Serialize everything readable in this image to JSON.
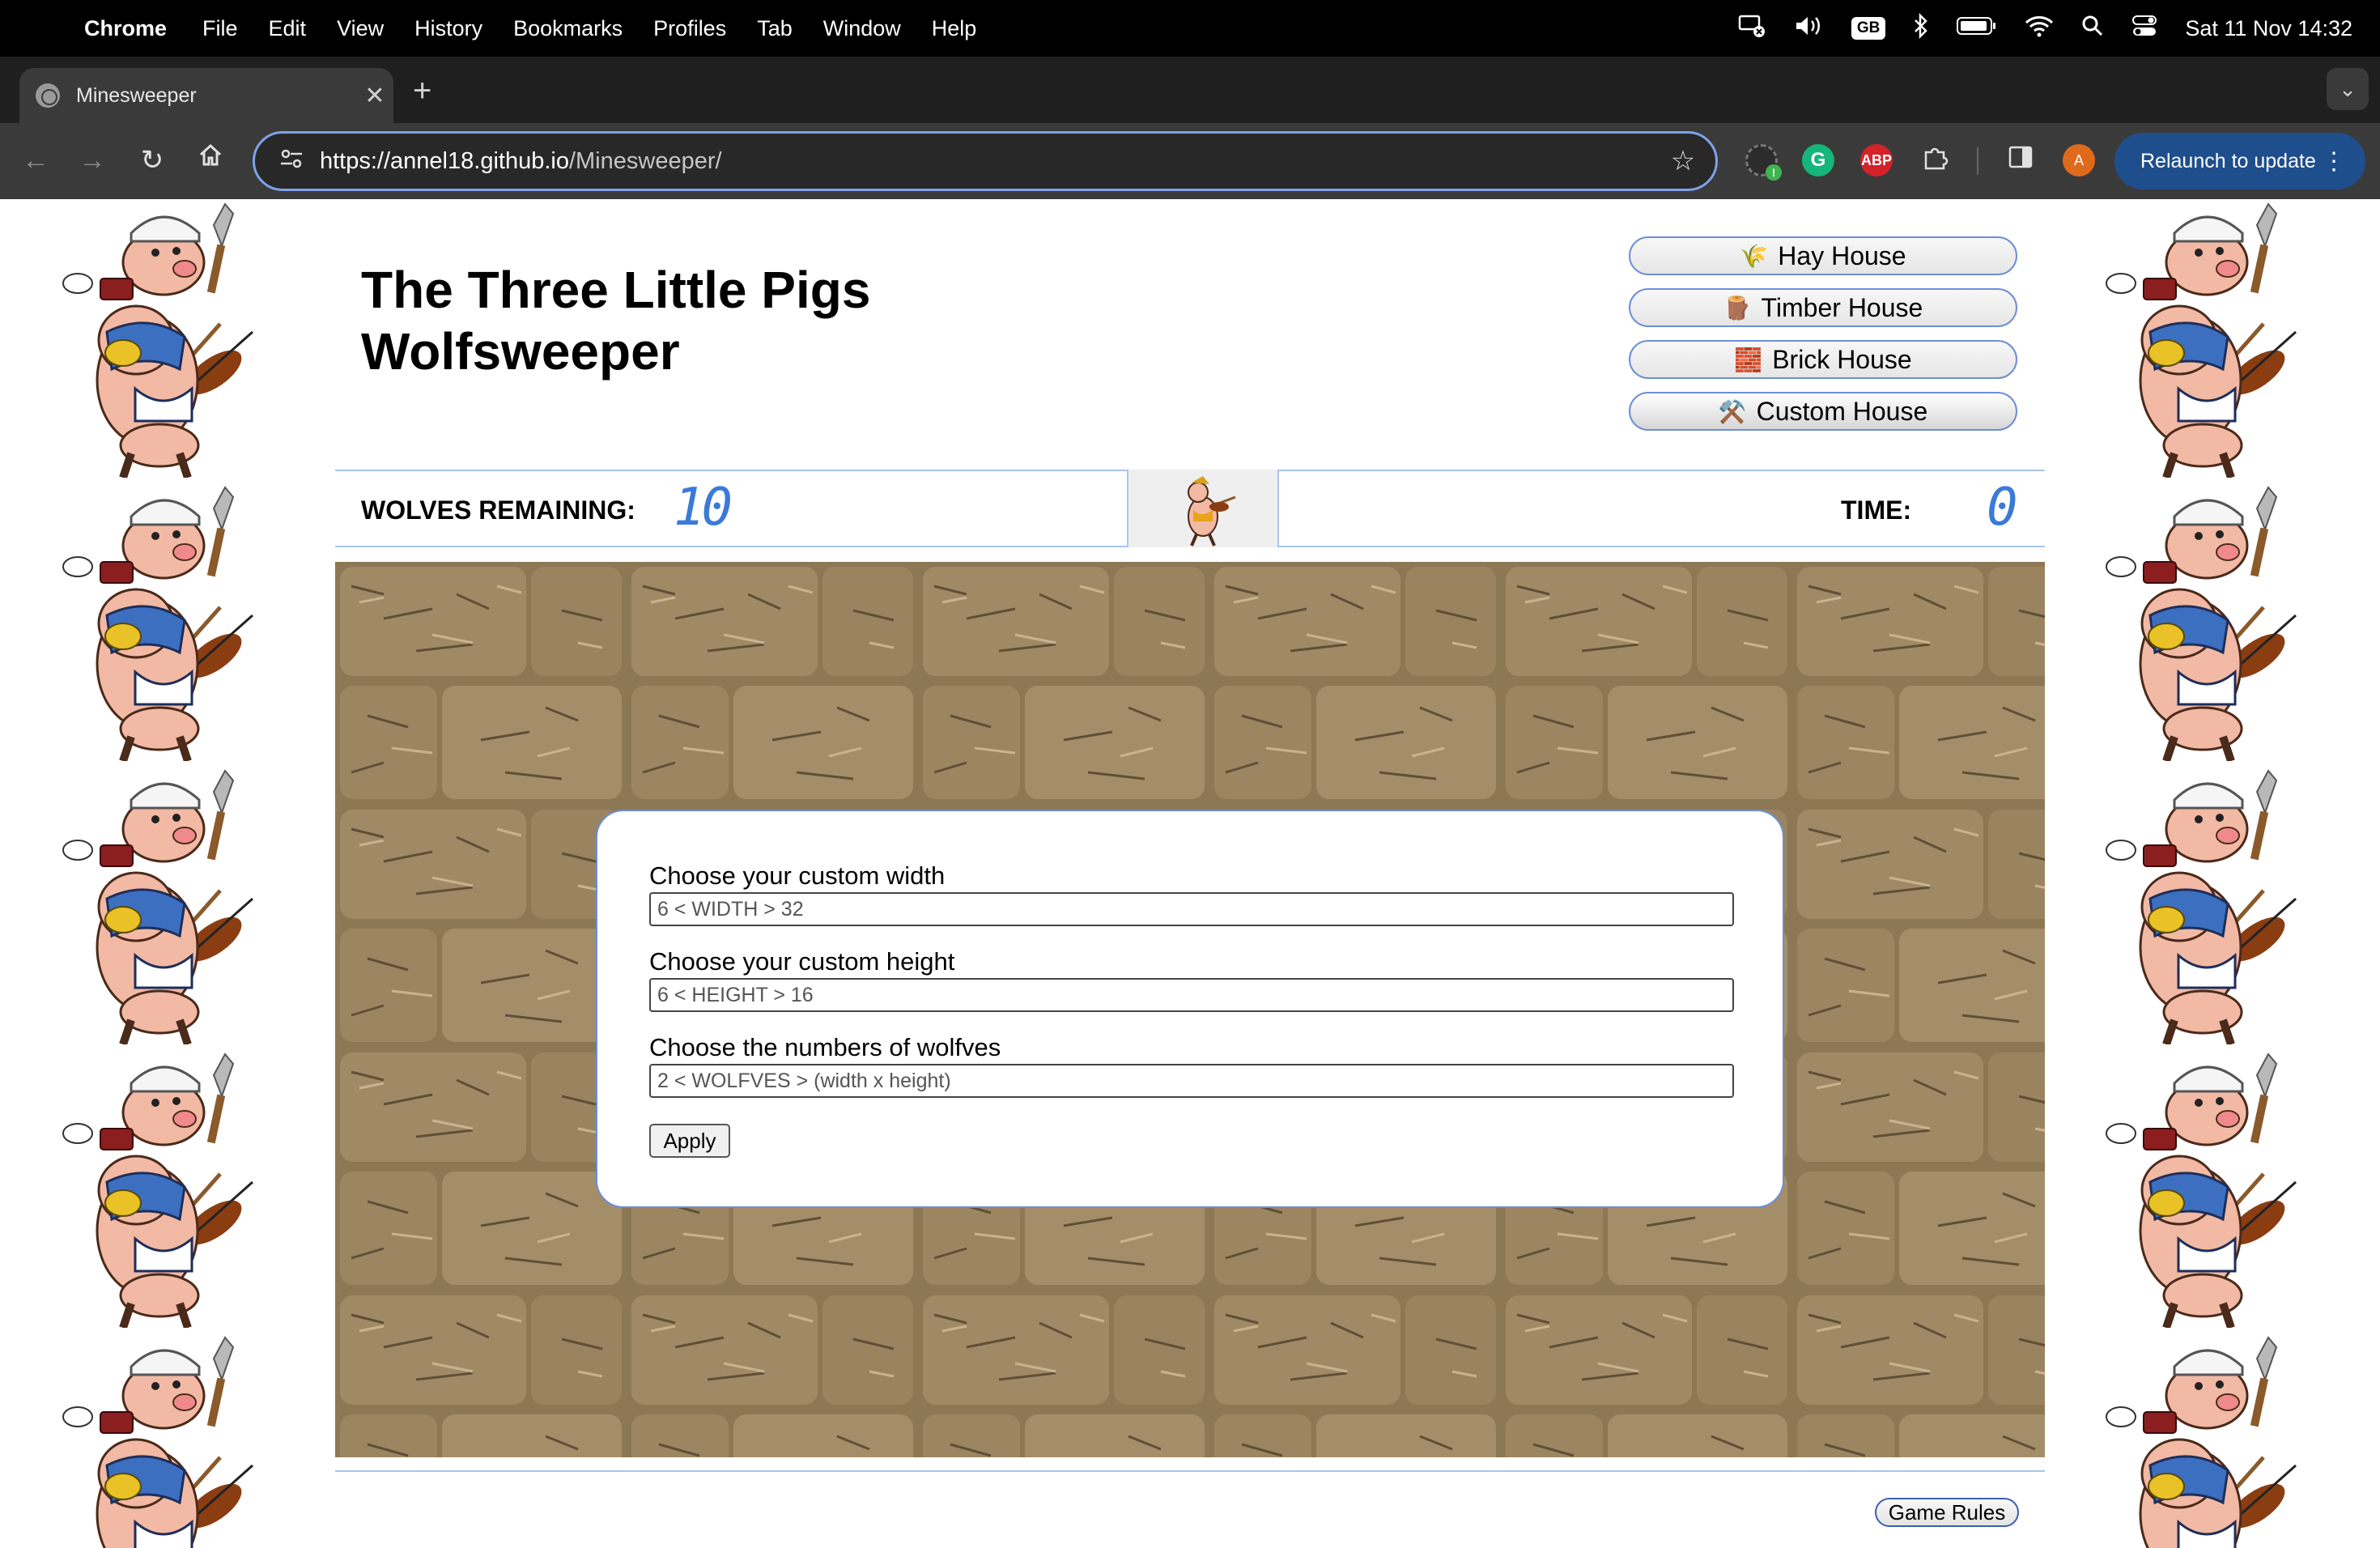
{
  "menubar": {
    "app": "Chrome",
    "items": [
      "File",
      "Edit",
      "View",
      "History",
      "Bookmarks",
      "Profiles",
      "Tab",
      "Window",
      "Help"
    ],
    "keyboard": "GB",
    "datetime": "Sat 11 Nov  14:32"
  },
  "browser": {
    "tab_title": "Minesweeper",
    "url_host": "https://annel18.github.io",
    "url_path": "/Minesweeper/",
    "relaunch_label": "Relaunch to update",
    "abp_label": "ABP",
    "profile_initial": "A"
  },
  "game": {
    "title_line1": "The Three Little Pigs",
    "title_line2": "Wolfsweeper",
    "houses": [
      {
        "icon": "🌾",
        "label": "Hay House"
      },
      {
        "icon": "🪵",
        "label": "Timber House"
      },
      {
        "icon": "🧱",
        "label": "Brick House"
      },
      {
        "icon": "⚒️",
        "label": "Custom House"
      }
    ],
    "wolves_label": "WOLVES REMAINING:",
    "wolves_count": "10",
    "time_label": "TIME:",
    "time_count": "0",
    "modal": {
      "width_label": "Choose your custom width",
      "width_placeholder": "6 < WIDTH > 32",
      "height_label": "Choose your custom height",
      "height_placeholder": "6 < HEIGHT > 16",
      "wolves_label": "Choose the numbers of wolfves",
      "wolves_placeholder": "2 < WOLFVES > (width x height)",
      "apply_label": "Apply"
    },
    "rules_label": "Game Rules"
  }
}
